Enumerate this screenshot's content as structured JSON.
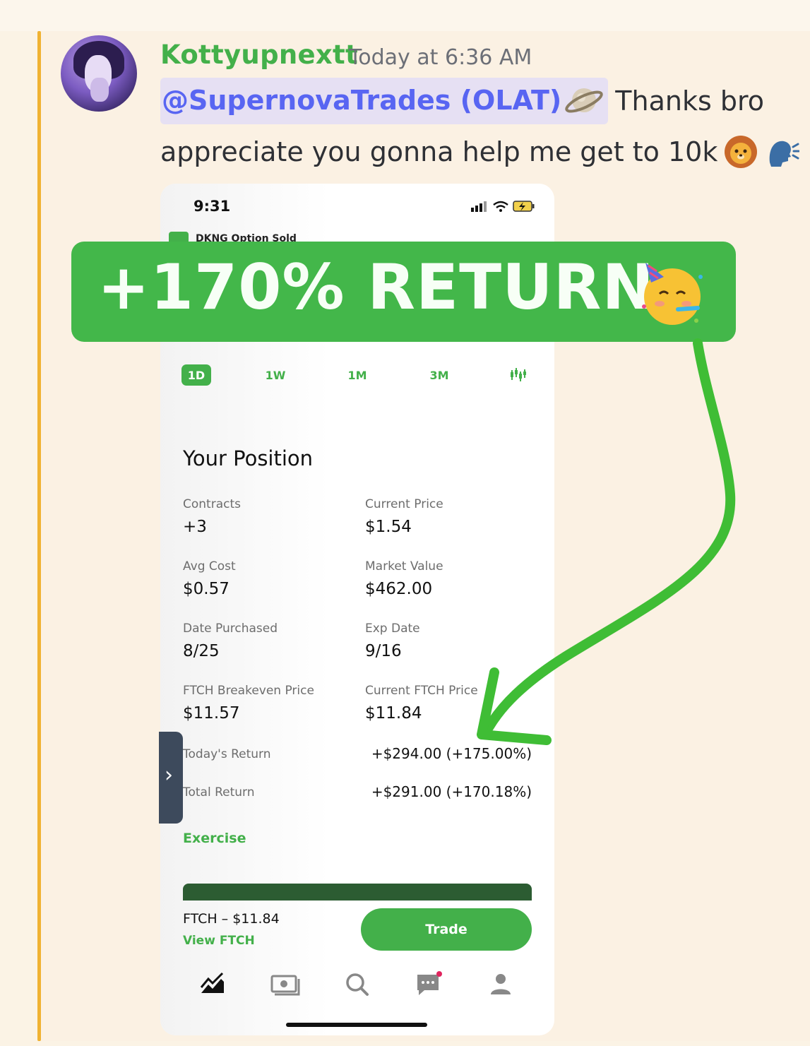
{
  "message": {
    "username": "Kottyupnextt",
    "timestamp": "Today at 6:36 AM",
    "mention": "@SupernovaTrades (OLAT)",
    "text_line1": "Thanks bro",
    "text_line2": "appreciate you gonna help me get to 10k",
    "emojis": [
      "ringed-planet-icon",
      "lion-face-icon",
      "speaking-head-icon"
    ],
    "colors": {
      "username": "#43b04a",
      "mention_text": "#5865f2",
      "accent_bar": "#f0b232"
    }
  },
  "banner": {
    "text": "+170% RETURN",
    "emoji": "partying-face-icon",
    "color": "#43b74a"
  },
  "phone": {
    "status_time": "9:31",
    "ranges": [
      "1D",
      "1W",
      "1M",
      "3M"
    ],
    "selected_range": "1D",
    "position_title": "Your Position",
    "fields": {
      "contracts_label": "Contracts",
      "contracts_value": "+3",
      "current_price_label": "Current Price",
      "current_price_value": "$1.54",
      "avg_cost_label": "Avg Cost",
      "avg_cost_value": "$0.57",
      "market_value_label": "Market Value",
      "market_value_value": "$462.00",
      "date_purchased_label": "Date Purchased",
      "date_purchased_value": "8/25",
      "exp_date_label": "Exp Date",
      "exp_date_value": "9/16",
      "breakeven_label": "FTCH Breakeven Price",
      "breakeven_value": "$11.57",
      "current_ftch_label": "Current FTCH Price",
      "current_ftch_value": "$11.84"
    },
    "todays_return_label": "Today's Return",
    "todays_return_value": "+$294.00 (+175.00%)",
    "total_return_label": "Total Return",
    "total_return_value": "+$291.00 (+170.18%)",
    "exercise_label": "Exercise",
    "ticker_label": "FTCH – $11.84",
    "view_ticker_label": "View FTCH",
    "trade_label": "Trade",
    "tabs": [
      "chart-icon",
      "cash-icon",
      "search-icon",
      "messages-icon",
      "account-icon"
    ],
    "colors": {
      "brand_green": "#43b04a"
    }
  }
}
